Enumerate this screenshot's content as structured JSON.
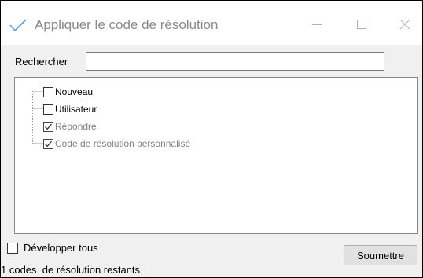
{
  "window": {
    "title": "Appliquer le code de résolution",
    "accent_color": "#5a9fd8"
  },
  "search": {
    "label": "Rechercher",
    "value": "",
    "placeholder": ""
  },
  "tree": {
    "items": [
      {
        "label": "Nouveau",
        "checked": false,
        "disabled": false
      },
      {
        "label": "Utilisateur",
        "checked": false,
        "disabled": false
      },
      {
        "label": "Répondre",
        "checked": true,
        "disabled": true
      },
      {
        "label": "Code de résolution personnalisé",
        "checked": true,
        "disabled": true
      }
    ]
  },
  "footer": {
    "expand_all_label": "Développer tous",
    "expand_all_checked": false,
    "submit_label": "Soumettre",
    "status_text": "1 codes  de résolution restants"
  }
}
